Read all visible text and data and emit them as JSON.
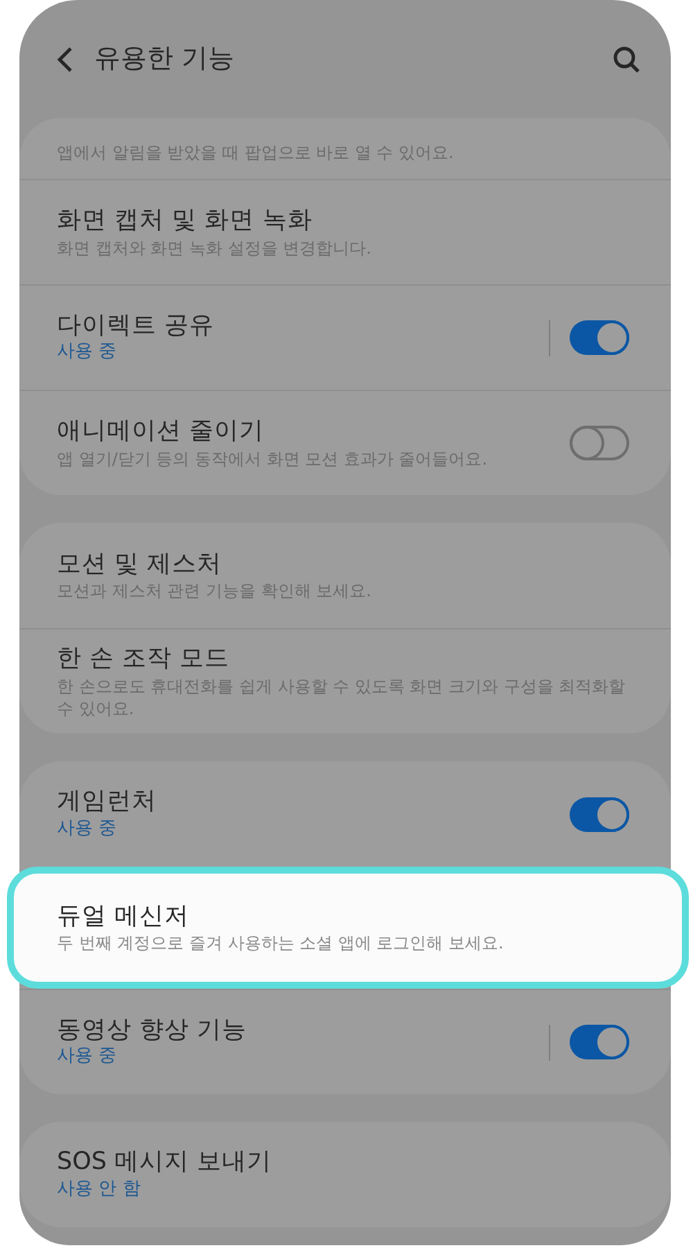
{
  "header": {
    "title": "유용한 기능"
  },
  "groups": [
    {
      "items": [
        {
          "kind": "plain",
          "subtitle": "앱에서 알림을 받았을 때 팝업으로 바로 열 수 있어요."
        },
        {
          "kind": "plain",
          "title": "화면 캡처 및 화면 녹화",
          "subtitle": "화면 캡처와 화면 녹화 설정을 변경합니다."
        },
        {
          "kind": "toggle",
          "title": "다이렉트 공유",
          "status": "사용 중",
          "on": true,
          "separator": true
        },
        {
          "kind": "toggle",
          "title": "애니메이션 줄이기",
          "subtitle": "앱 열기/닫기 등의 동작에서 화면 모션 효과가 줄어들어요.",
          "on": false,
          "separator": false
        }
      ]
    },
    {
      "items": [
        {
          "kind": "plain",
          "title": "모션 및 제스처",
          "subtitle": "모션과 제스처 관련 기능을 확인해 보세요."
        },
        {
          "kind": "plain",
          "title": "한 손 조작 모드",
          "subtitle": "한 손으로도 휴대전화를 쉽게 사용할 수 있도록 화면 크기와 구성을 최적화할 수 있어요."
        }
      ]
    },
    {
      "items": [
        {
          "kind": "toggle",
          "title": "게임런처",
          "status": "사용 중",
          "on": true,
          "separator": false
        },
        {
          "kind": "plain",
          "title": "듀얼 메신저",
          "subtitle": "두 번째 계정으로 즐겨 사용하는 소셜 앱에 로그인해 보세요.",
          "highlighted": true
        },
        {
          "kind": "toggle",
          "title": "동영상 향상 기능",
          "status": "사용 중",
          "on": true,
          "separator": true
        }
      ]
    },
    {
      "items": [
        {
          "kind": "plain",
          "title": "SOS 메시지 보내기",
          "status": "사용 안 함"
        }
      ]
    }
  ]
}
